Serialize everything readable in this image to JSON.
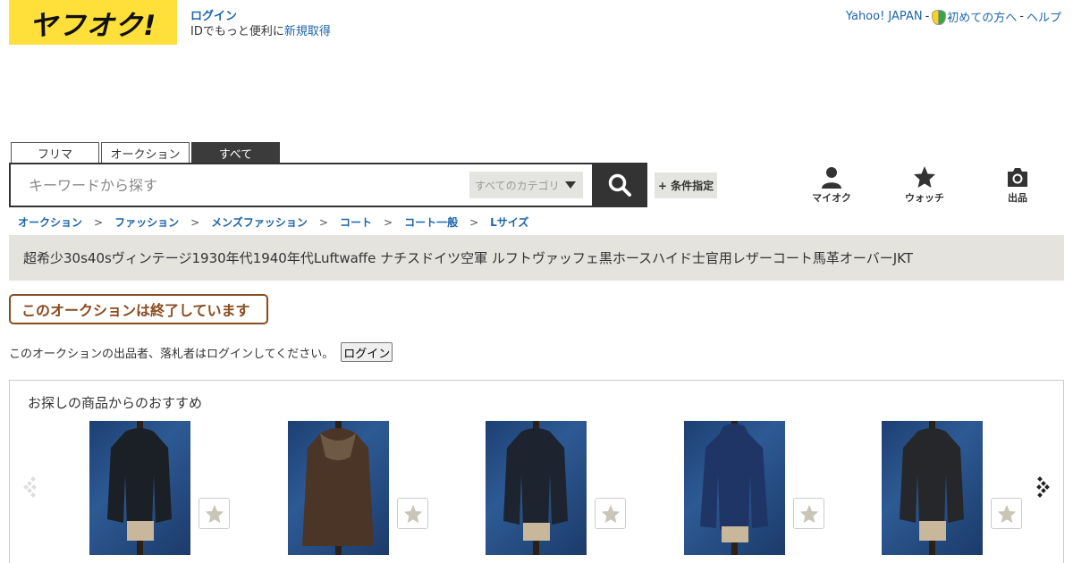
{
  "header": {
    "logo_text": "ヤフオク!",
    "login_link": "ログイン",
    "login_prompt": "IDでもっと便利に",
    "register_link": "新規取得",
    "links": {
      "yahoo_japan": "Yahoo! JAPAN",
      "beginners": "初めての方へ",
      "help": "ヘルプ",
      "separator": "-"
    }
  },
  "search": {
    "tabs": [
      "フリマ",
      "オークション",
      "すべて"
    ],
    "active_tab": "すべて",
    "placeholder": "キーワードから探す",
    "category_selected": "すべてのカテゴリ",
    "conditions_button": "+ 条件指定",
    "search_icon": "search-icon"
  },
  "nav": {
    "my": {
      "label": "マイオク",
      "icon": "person-icon"
    },
    "watch": {
      "label": "ウォッチ",
      "icon": "star-icon"
    },
    "sell": {
      "label": "出品",
      "icon": "camera-icon"
    }
  },
  "breadcrumb": [
    "オークション",
    "ファッション",
    "メンズファッション",
    "コート",
    "コート一般",
    "Lサイズ"
  ],
  "breadcrumb_separator": ">",
  "item": {
    "title": "超希少30s40sヴィンテージ1930年代1940年代Luftwaffe ナチスドイツ空軍 ルフトヴァッフェ黒ホースハイド士官用レザーコート馬革オーバーJKT",
    "status": "このオークションは終了しています",
    "login_note": "このオークションの出品者、落札者はログインしてください。",
    "login_button": "ログイン"
  },
  "recommendations": {
    "title": "お探しの商品からのおすすめ",
    "items": [
      {
        "image": "black-leather-jacket-photo",
        "color": "#1b1f26"
      },
      {
        "image": "brown-leather-coat-photo",
        "color": "#4a3527"
      },
      {
        "image": "black-leather-jacket-photo",
        "color": "#1d2430"
      },
      {
        "image": "navy-denim-jacket-photo",
        "color": "#1f3566"
      },
      {
        "image": "black-leather-jacket-photo",
        "color": "#26272b"
      }
    ]
  },
  "colors": {
    "brand_yellow": "#ffe03a",
    "link_blue": "#1d66aa",
    "ended_brown": "#8a4b1e"
  }
}
